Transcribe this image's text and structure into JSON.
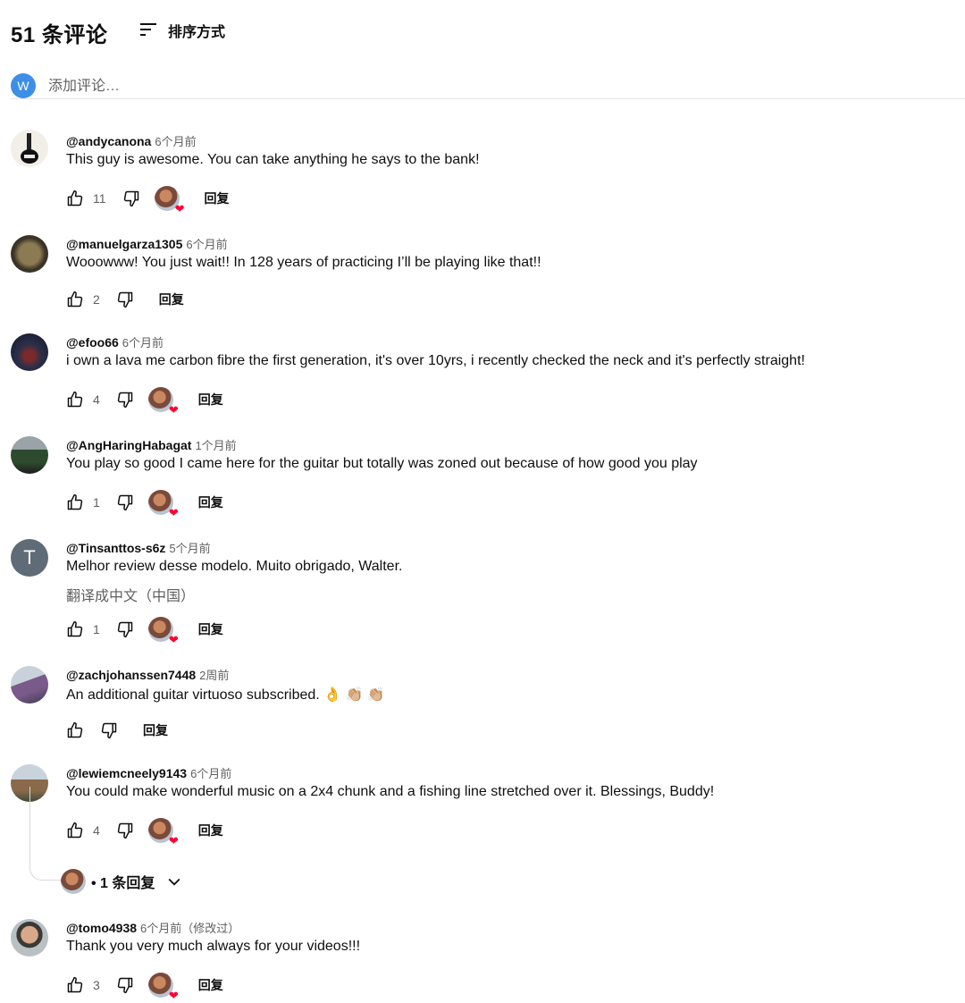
{
  "header": {
    "comment_count": "51 条评论",
    "sort_label": "排序方式"
  },
  "add_comment": {
    "avatar_letter": "W",
    "placeholder": "添加评论…"
  },
  "icons": {
    "like": "thumbs-up-icon",
    "dislike": "thumbs-down-icon",
    "sort": "sort-lines-icon",
    "heart": "heart-icon",
    "chevron": "chevron-down-icon"
  },
  "colors": {
    "heart": "#ff0033",
    "add_avatar": "#3d8ee6",
    "secondary_text": "#606060"
  },
  "comments": [
    {
      "author": "@andycanona",
      "time": "6个月前",
      "text": "This guy is awesome.  You can take anything he says to the bank!",
      "likes": "11",
      "creator_heart": true,
      "reply": "回复"
    },
    {
      "author": "@manuelgarza1305",
      "time": "6个月前",
      "text": "Wooowww! You just wait!! In 128 years of practicing I’ll be playing like that!!",
      "likes": "2",
      "creator_heart": false,
      "reply": "回复"
    },
    {
      "author": "@efoo66",
      "time": "6个月前",
      "text": "i own a lava me carbon fibre the first generation, it's over 10yrs, i recently checked the neck and it's perfectly straight!",
      "likes": "4",
      "creator_heart": true,
      "reply": "回复"
    },
    {
      "author": "@AngHaringHabagat",
      "time": "1个月前",
      "text": "You play so good I came here for the guitar but totally was zoned out because of how good you play",
      "likes": "1",
      "creator_heart": true,
      "reply": "回复"
    },
    {
      "author": "@Tinsanttos-s6z",
      "time": "5个月前",
      "avatar_letter": "T",
      "text": "Melhor review desse modelo. Muito obrigado, Walter.",
      "translate": "翻译成中文（中国）",
      "likes": "1",
      "creator_heart": true,
      "reply": "回复"
    },
    {
      "author": "@zachjohanssen7448",
      "time": "2周前",
      "text": "An additional guitar virtuoso subscribed. 👌 👏🏼 👏🏼",
      "likes": "",
      "creator_heart": false,
      "reply": "回复"
    },
    {
      "author": "@lewiemcneely9143",
      "time": "6个月前",
      "text": "You could make wonderful music on a 2x4 chunk and a fishing line stretched over it. Blessings, Buddy!",
      "likes": "4",
      "creator_heart": true,
      "reply": "回复",
      "replies_toggle": "• 1 条回复"
    },
    {
      "author": "@tomo4938",
      "time": "6个月前（修改过）",
      "text": "Thank you very much always for your videos!!!",
      "likes": "3",
      "creator_heart": true,
      "reply": "回复"
    }
  ]
}
